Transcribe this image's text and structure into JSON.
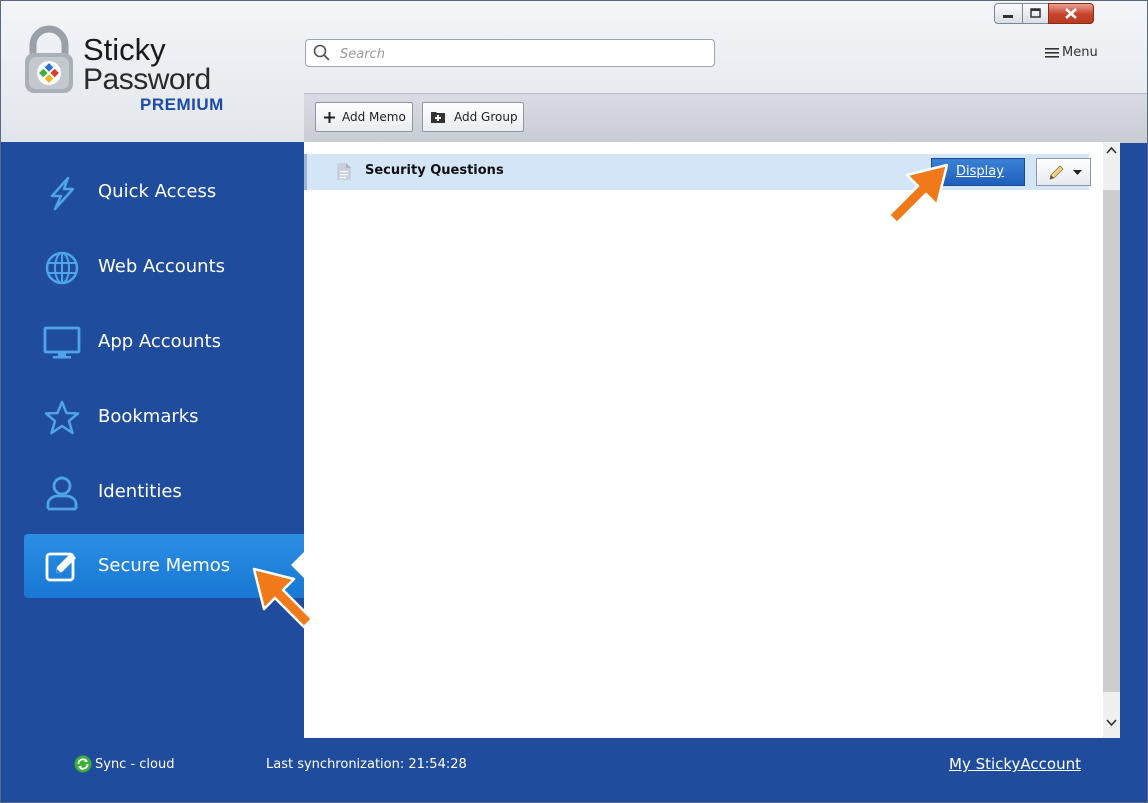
{
  "app": {
    "brand_line1": "Sticky",
    "brand_line2": "Password",
    "brand_line3": "PREMIUM"
  },
  "search": {
    "placeholder": "Search",
    "value": ""
  },
  "menu": {
    "label": "Menu"
  },
  "toolbar": {
    "add_memo_label": "Add Memo",
    "add_group_label": "Add Group"
  },
  "sidebar": {
    "items": [
      {
        "label": "Quick Access",
        "icon": "lightning-icon",
        "active": false
      },
      {
        "label": "Web Accounts",
        "icon": "globe-icon",
        "active": false
      },
      {
        "label": "App Accounts",
        "icon": "monitor-icon",
        "active": false
      },
      {
        "label": "Bookmarks",
        "icon": "star-icon",
        "active": false
      },
      {
        "label": "Identities",
        "icon": "person-icon",
        "active": false
      },
      {
        "label": "Secure Memos",
        "icon": "memo-edit-icon",
        "active": true
      }
    ]
  },
  "memos": [
    {
      "title": "Security Questions",
      "action_label": "Display"
    }
  ],
  "status": {
    "sync_label": "Sync - cloud",
    "last_sync": "Last synchronization: 21:54:28",
    "account_link": "My StickyAccount"
  },
  "colors": {
    "sidebar_bg": "#1f4c9c",
    "active_item": "#2086dc",
    "row_highlight": "#d4e5f7",
    "display_button": "#2a6ec8",
    "arrow": "#f07a1a"
  }
}
